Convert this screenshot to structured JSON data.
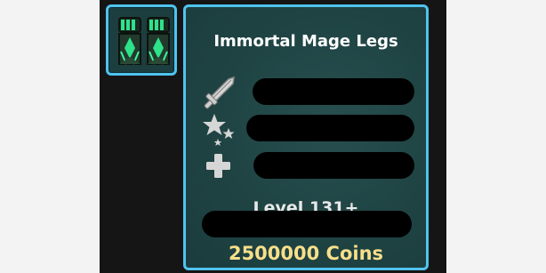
{
  "item": {
    "name": "Immortal Mage Legs",
    "level_requirement": "Level 131+",
    "price": "2500000 Coins"
  },
  "icons": {
    "item": "mage-legs-armor-icon",
    "stat_1": "sword-damage-icon",
    "stat_2": "stars-magic-icon",
    "stat_3": "plus-health-icon"
  },
  "colors": {
    "border": "#4fc3ef",
    "panel_bg": "#1f4444",
    "price": "#f7df8a",
    "item_accent": "#2ee28a"
  }
}
